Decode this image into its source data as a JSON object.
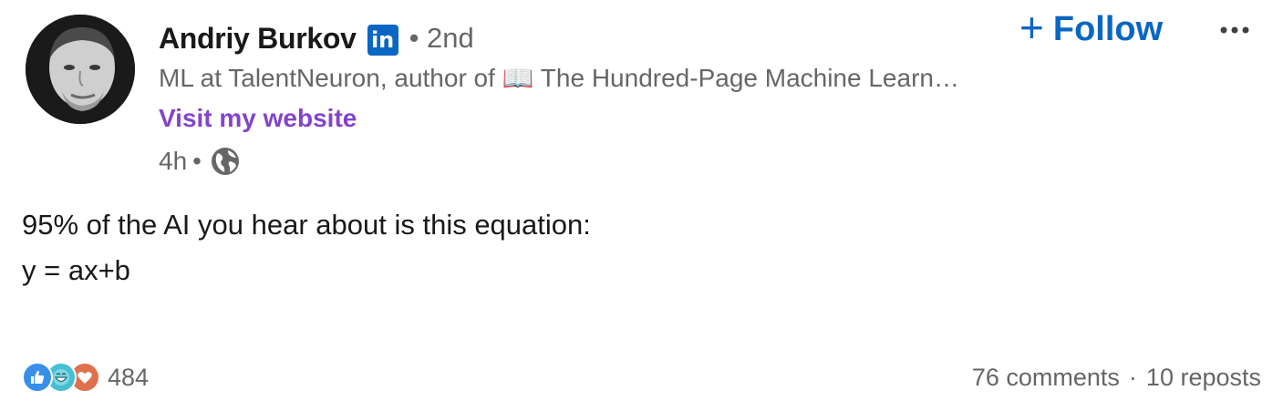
{
  "author": {
    "name": "Andriy Burkov",
    "badge": "in",
    "degree": "• 2nd",
    "headline": "ML at TalentNeuron, author of 📖 The Hundred-Page Machine Learn…",
    "website_label": "Visit my website"
  },
  "meta": {
    "time": "4h",
    "separator": "•",
    "visibility_icon": "globe-icon"
  },
  "actions": {
    "follow_label": "Follow",
    "follow_icon": "plus-icon",
    "more_icon": "more-horizontal-icon"
  },
  "post": {
    "lines": [
      "95% of the AI you hear about is this equation:",
      "",
      "y = ax+b"
    ]
  },
  "social": {
    "reactions": [
      "like-reaction-icon",
      "funny-reaction-icon",
      "love-reaction-icon"
    ],
    "reaction_count": "484",
    "comments": "76 comments",
    "separator": "·",
    "reposts": "10 reposts"
  },
  "colors": {
    "brand_blue": "#0a66c2",
    "link_purple": "#8344cc",
    "secondary_text": "#666666",
    "like": "#378fe9",
    "funny": "#44bfd3",
    "love": "#df704d"
  }
}
